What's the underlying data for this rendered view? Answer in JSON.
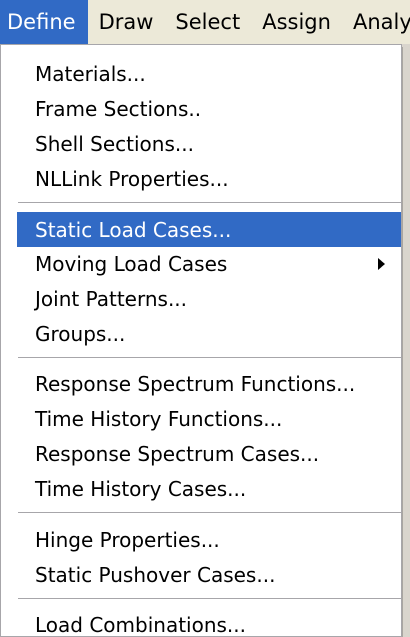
{
  "menubar": {
    "items": [
      {
        "label": "Define"
      },
      {
        "label": "Draw"
      },
      {
        "label": "Select"
      },
      {
        "label": "Assign"
      },
      {
        "label": "Analyz"
      }
    ]
  },
  "menu": {
    "items": [
      {
        "label": "Materials..."
      },
      {
        "label": "Frame Sections.."
      },
      {
        "label": "Shell Sections..."
      },
      {
        "label": "NLLink Properties..."
      },
      {
        "label": "Static Load Cases..."
      },
      {
        "label": "Moving Load Cases"
      },
      {
        "label": "Joint Patterns..."
      },
      {
        "label": "Groups..."
      },
      {
        "label": "Response Spectrum Functions..."
      },
      {
        "label": "Time History Functions..."
      },
      {
        "label": "Response Spectrum Cases..."
      },
      {
        "label": "Time History Cases..."
      },
      {
        "label": "Hinge Properties..."
      },
      {
        "label": "Static Pushover Cases..."
      },
      {
        "label": "Load Combinations..."
      }
    ]
  },
  "colors": {
    "selection": "#316ac5",
    "menubar": "#ece9d8",
    "menu_background": "#ffffff"
  },
  "icons": {
    "submenu": "chevron-right-icon"
  }
}
